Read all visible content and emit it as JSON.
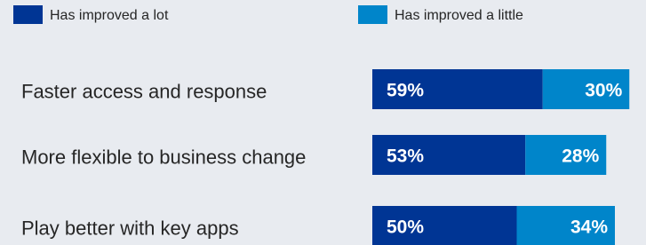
{
  "chart_data": {
    "type": "bar",
    "orientation": "horizontal",
    "stacked": true,
    "categories": [
      "Faster access and response",
      "More flexible to business change",
      "Play better with key apps"
    ],
    "series": [
      {
        "name": "Has improved  a lot",
        "values": [
          59,
          53,
          50
        ],
        "labels": [
          "59%",
          "53%",
          "50%"
        ],
        "color": "#003594"
      },
      {
        "name": "Has improved  a little",
        "values": [
          30,
          28,
          34
        ],
        "labels": [
          "30%",
          "28%",
          "34%"
        ],
        "color": "#0085ca"
      }
    ],
    "xlim": [
      0,
      100
    ],
    "grid": false,
    "legend_position": "top"
  }
}
